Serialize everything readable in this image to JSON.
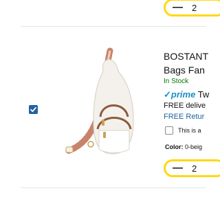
{
  "prev_item": {
    "quantity": "2",
    "minus_symbol": "—"
  },
  "item": {
    "checked": true,
    "title_line1": "BOSTANT",
    "title_line2": "Bags Fan",
    "stock": "In Stock",
    "prime_check": "✓",
    "prime_brand": "prime",
    "prime_text": "Tw",
    "delivery": "FREE delive",
    "returns": "FREE Retur",
    "gift_label": "This is a",
    "color_label": "Color:",
    "color_value": "0-beig",
    "quantity": "2",
    "minus_symbol": "—"
  },
  "colors": {
    "stepper_border": "#ffd814",
    "checkbox": "#2162a1",
    "stock": "#007600",
    "prime": "#1a8ec6",
    "link": "#2162a1",
    "strap": "#c8846a",
    "bag_body": "#f4f1ec",
    "bag_trim": "#8b5a3c"
  }
}
